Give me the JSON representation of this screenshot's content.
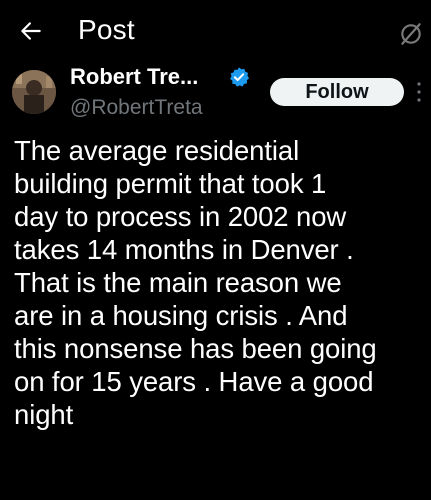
{
  "header": {
    "title": "Post",
    "back_icon": "arrow-left-icon",
    "action_icon": "slash-circle-icon"
  },
  "author": {
    "name": "Robert Tre...",
    "handle": "@RobertTreta",
    "verified": true,
    "verified_color": "#1d9bf0"
  },
  "follow_button": {
    "label": "Follow"
  },
  "post": {
    "lines": [
      "The average residential",
      "building permit that took 1",
      "day to process in 2002 now",
      "takes 14 months in Denver .",
      "That is the main reason we",
      "are in a housing crisis . And",
      "this nonsense has been going",
      "on for 15 years . Have a good",
      "night"
    ]
  },
  "colors": {
    "background": "#000000",
    "text": "#ffffff",
    "secondary_text": "#71767b",
    "button_background": "#eff3f4",
    "button_text": "#0f1419"
  }
}
